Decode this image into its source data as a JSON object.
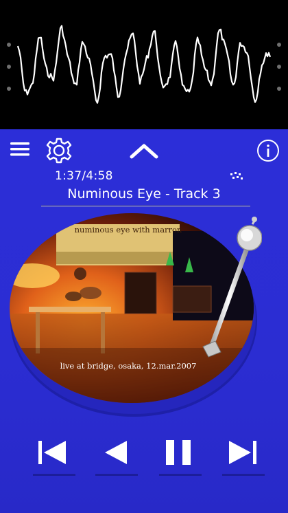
{
  "waveform": {
    "label_icon": "waveform-visualizer"
  },
  "toolbar": {
    "menu_icon": "hamburger-menu-icon",
    "settings_icon": "gear-icon",
    "collapse_icon": "chevron-up-icon",
    "info_icon": "info-icon"
  },
  "playback": {
    "time": "1:37/4:58",
    "position_seconds": 97,
    "duration_seconds": 298,
    "connection_icon": "connection-dots-icon"
  },
  "track": {
    "title": "Numinous Eye - Track 3"
  },
  "album_art": {
    "caption_top": "numinous eye with marron",
    "caption_bottom": "live at bridge, osaka, 12.mar.2007"
  },
  "controls": {
    "previous_icon": "skip-previous-icon",
    "rewind_icon": "play-reverse-icon",
    "pause_icon": "pause-icon",
    "next_icon": "skip-next-icon"
  },
  "colors": {
    "background": "#2d2fd6",
    "waveform_bg": "#000000",
    "accent": "#ffffff"
  }
}
